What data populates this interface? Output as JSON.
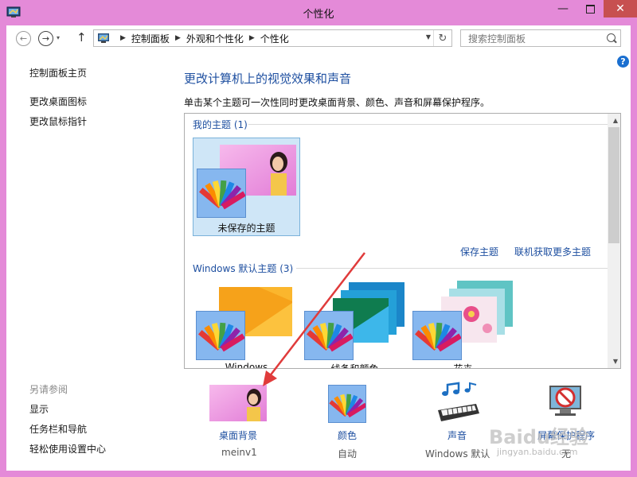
{
  "window": {
    "title": "个性化"
  },
  "nav": {
    "breadcrumbs": [
      "控制面板",
      "外观和个性化",
      "个性化"
    ],
    "search_placeholder": "搜索控制面板"
  },
  "sidebar": {
    "home": "控制面板主页",
    "links": [
      "更改桌面图标",
      "更改鼠标指针"
    ],
    "see_also_title": "另请参阅",
    "see_also": [
      "显示",
      "任务栏和导航",
      "轻松使用设置中心"
    ]
  },
  "main": {
    "heading": "更改计算机上的视觉效果和声音",
    "description": "单击某个主题可一次性同时更改桌面背景、颜色、声音和屏幕保护程序。",
    "my_themes_title": "我的主题 (1)",
    "unsaved_theme_label": "未保存的主题",
    "save_theme_link": "保存主题",
    "get_more_link": "联机获取更多主题",
    "default_themes_title": "Windows 默认主题 (3)",
    "default_themes": [
      "Windows",
      "线条和颜色",
      "花卉"
    ]
  },
  "bottom": {
    "desktop_bg": {
      "label": "桌面背景",
      "value": "meinv1"
    },
    "color": {
      "label": "颜色",
      "value": "自动"
    },
    "sound": {
      "label": "声音",
      "value": "Windows 默认"
    },
    "screensaver": {
      "label": "屏幕保护程序",
      "value": "无"
    }
  },
  "watermark": {
    "text": "Baidu经验",
    "sub": "jingyan.baidu.com"
  },
  "colors": {
    "frame": "#e48ad8",
    "link": "#1e4fa0",
    "selected_tile": "#cfe6f7",
    "close": "#c75050",
    "arrow": "#e03b3b"
  }
}
